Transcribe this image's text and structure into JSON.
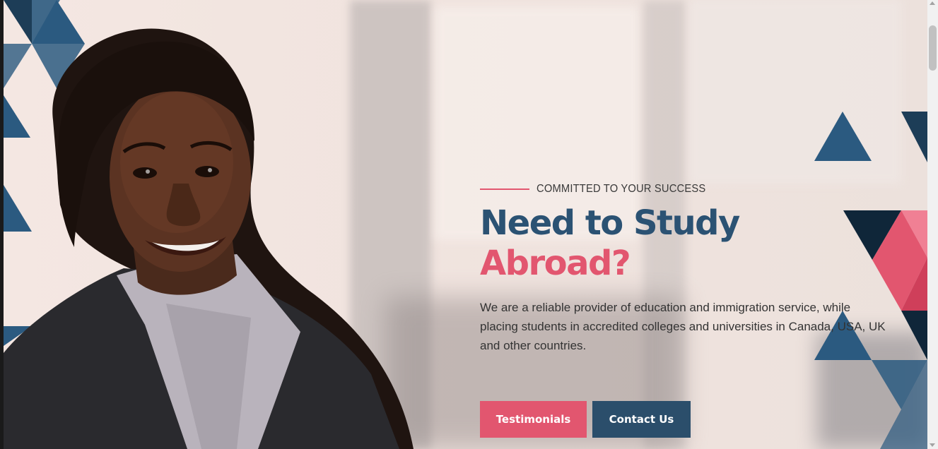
{
  "hero": {
    "eyebrow": "COMMITTED TO YOUR SUCCESS",
    "headline_line1": "Need to Study",
    "headline_line2": "Abroad?",
    "description": "We are a reliable provider of education and immigration service, while placing students in accredited colleges and universities in Canada, USA, UK and other countries.",
    "buttons": {
      "testimonials": "Testimonials",
      "contact": "Contact Us"
    },
    "image": "smiling-student-photo"
  },
  "colors": {
    "accent_pink": "#e2566f",
    "navy": "#2b5273",
    "dark_navy": "#1d3d57",
    "button_navy": "#2b4e6b"
  }
}
